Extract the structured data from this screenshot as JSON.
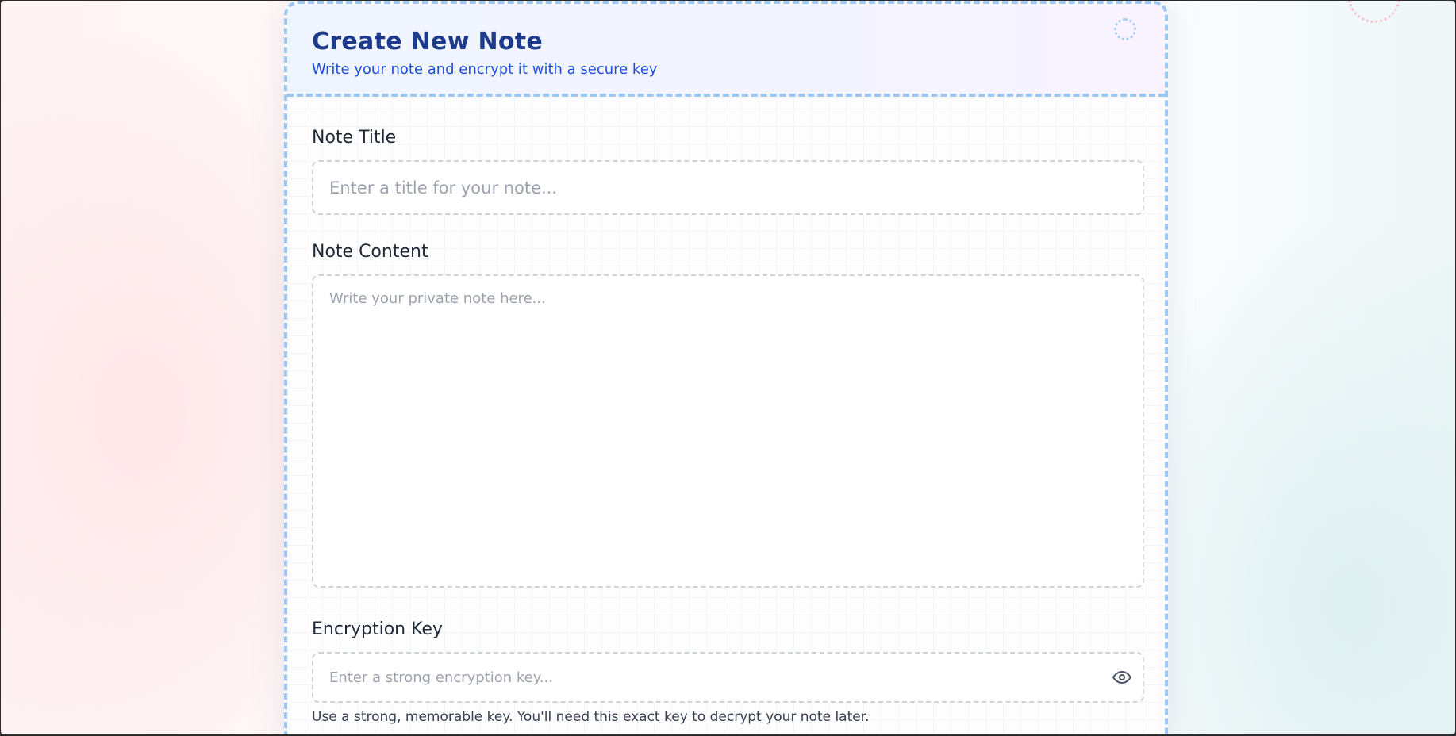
{
  "header": {
    "title": "Create New Note",
    "subtitle": "Write your note and encrypt it with a secure key"
  },
  "form": {
    "title_label": "Note Title",
    "title_placeholder": "Enter a title for your note...",
    "title_value": "",
    "content_label": "Note Content",
    "content_placeholder": "Write your private note here...",
    "content_value": "",
    "key_label": "Encryption Key",
    "key_placeholder": "Enter a strong encryption key...",
    "key_value": "",
    "key_hint": "Use a strong, memorable key. You'll need this exact key to decrypt your note later.",
    "key_toggle_icon": "eye-icon"
  },
  "colors": {
    "accent_border": "#9cc7f2",
    "title": "#1e3a8a",
    "subtitle": "#1d4ed8"
  }
}
